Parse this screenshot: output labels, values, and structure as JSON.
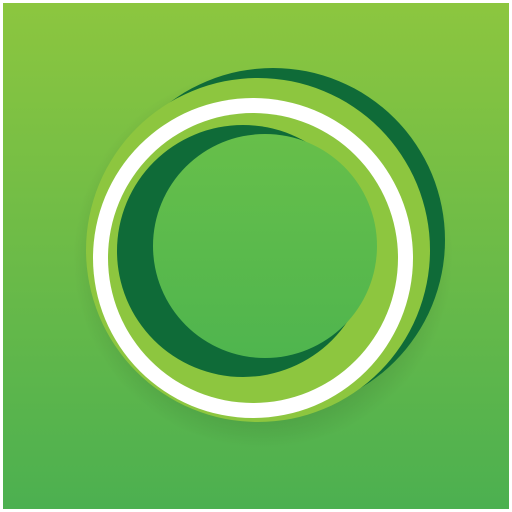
{
  "app_icon": {
    "name": "ring-logo-icon",
    "colors": {
      "background_top": "#8CC63F",
      "background_bottom": "#4CB050",
      "outer_ring_light": "#8DC63F",
      "outer_ring_dark": "#0F6B38",
      "white_ring": "#FFFFFF",
      "inner_ring_light": "#8DC63F",
      "inner_crescent_dark": "#0F6B38",
      "center_top": "#67BF4A",
      "center_bottom": "#4FB54E"
    }
  }
}
